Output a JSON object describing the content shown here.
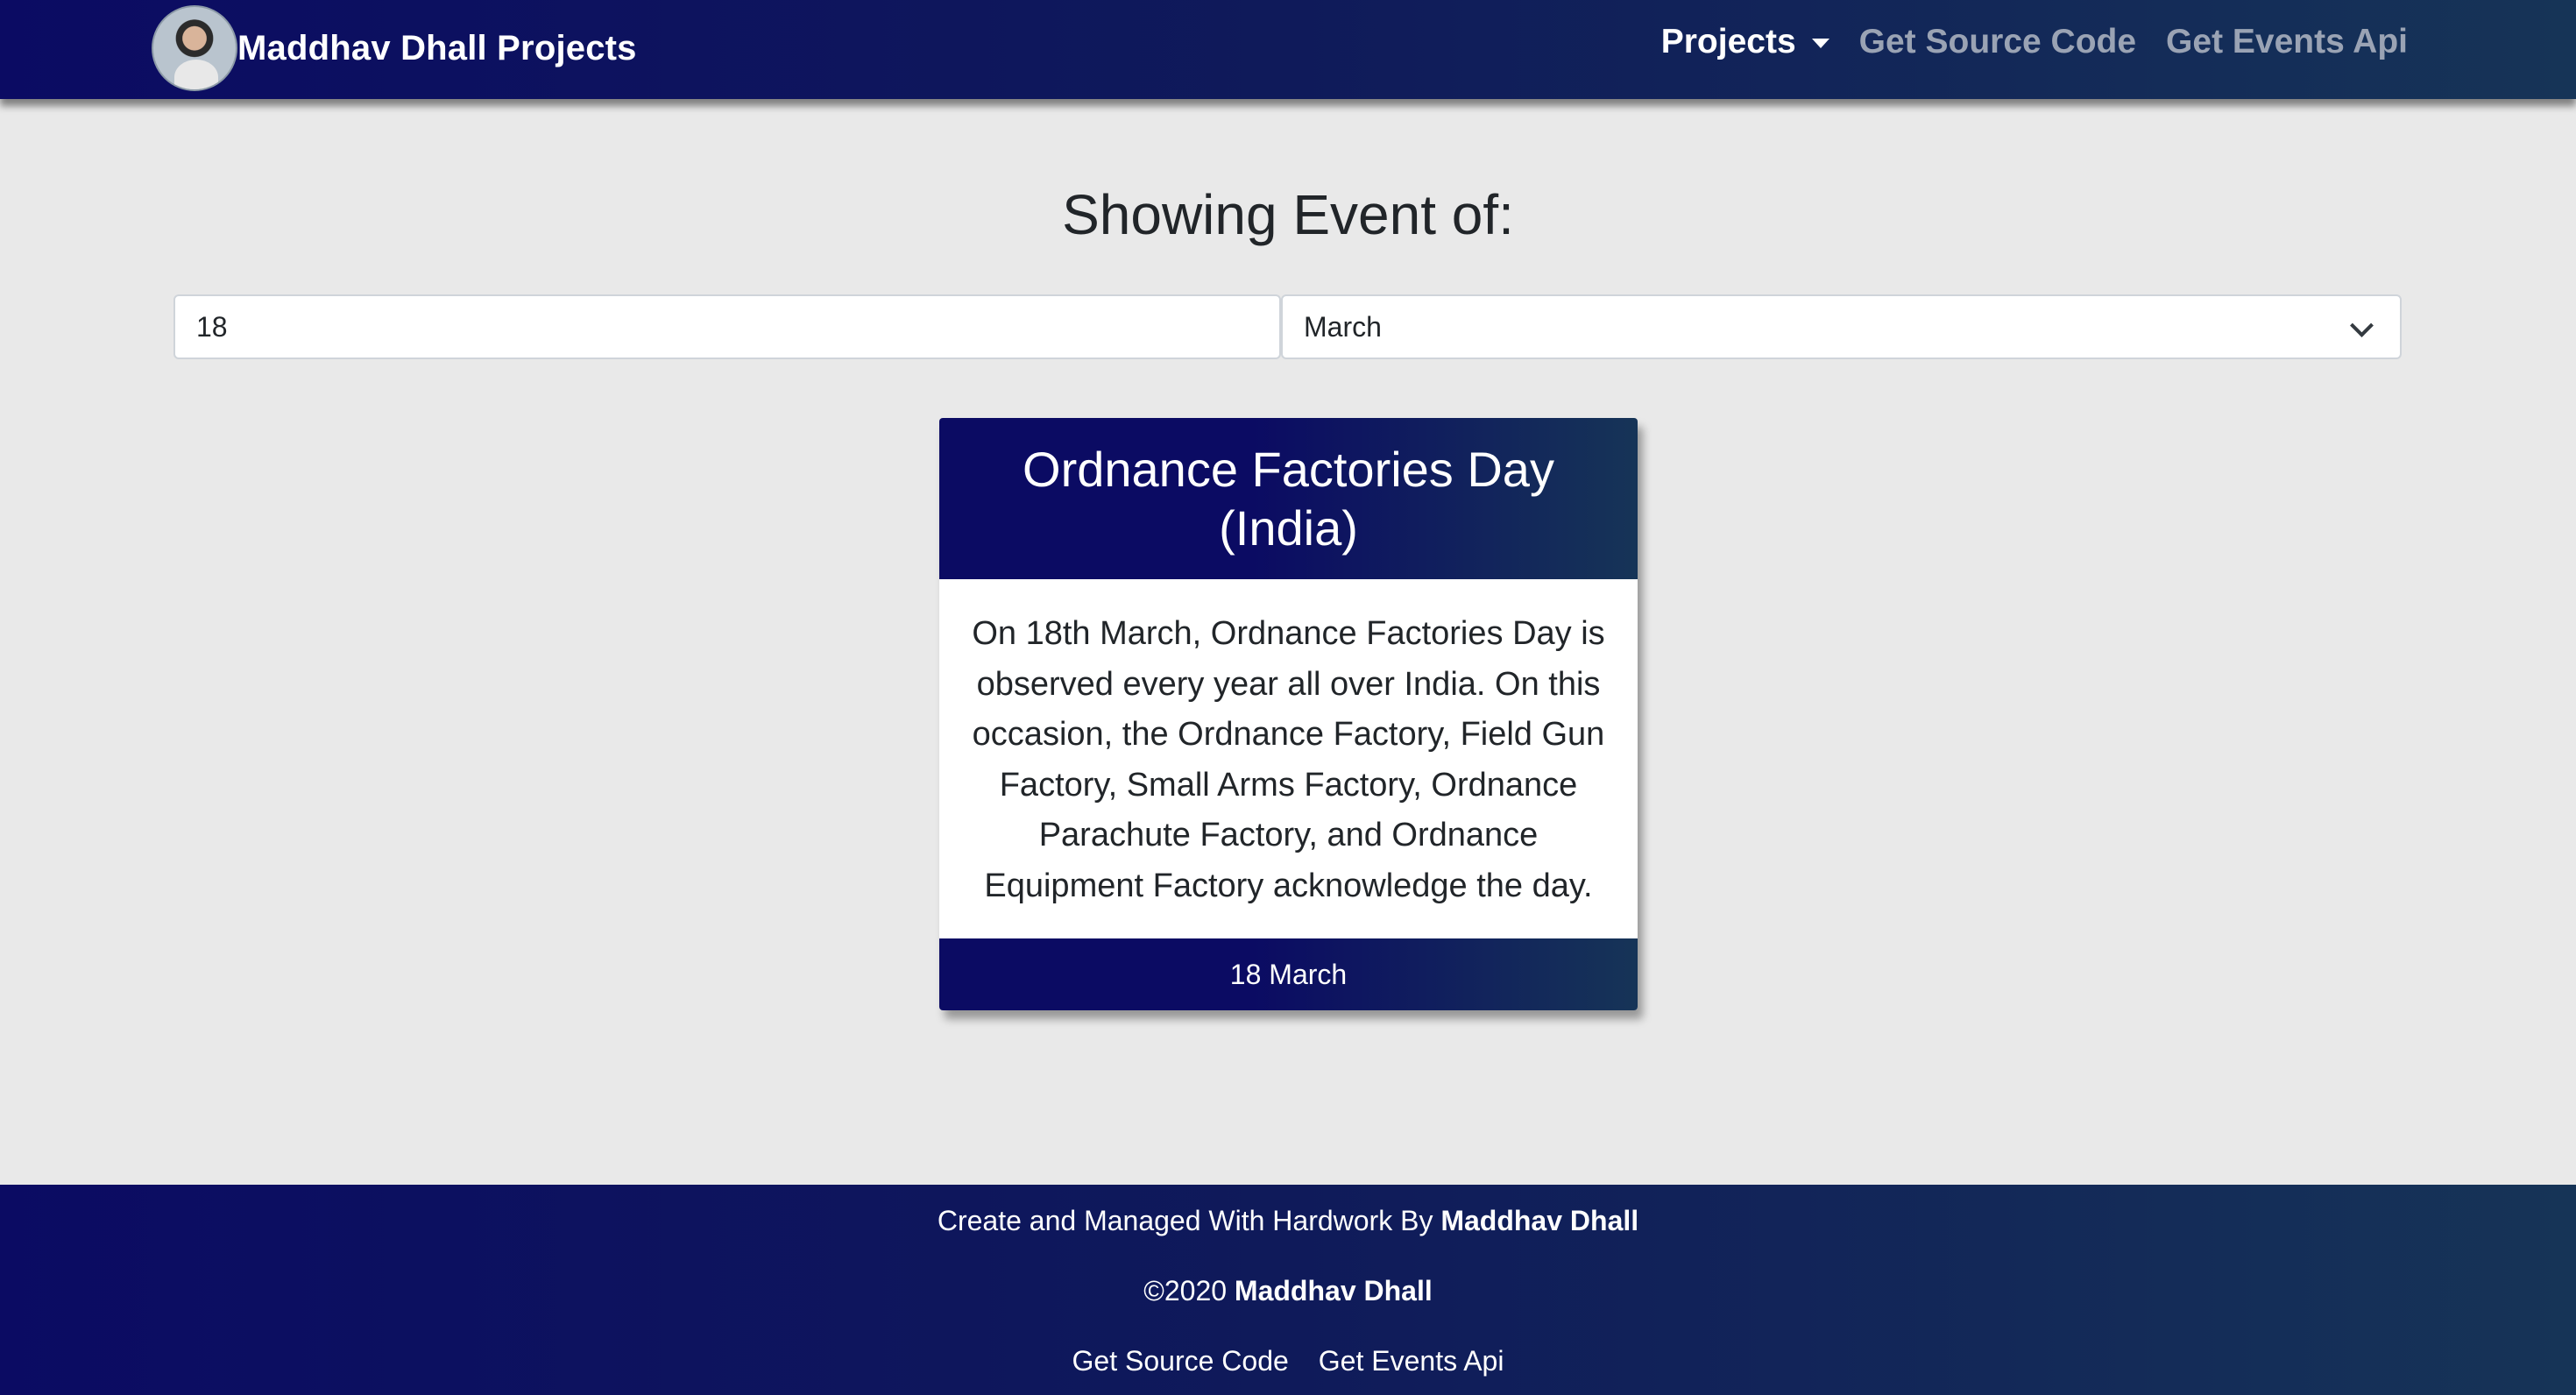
{
  "navbar": {
    "brand": "Maddhav Dhall Projects",
    "avatar_icon": "user-avatar-photo",
    "links": [
      {
        "label": "Projects",
        "active": true,
        "dropdown": true
      },
      {
        "label": "Get Source Code",
        "active": false
      },
      {
        "label": "Get Events Api",
        "active": false
      }
    ]
  },
  "main": {
    "heading": "Showing Event of:",
    "day_input_value": "18",
    "month_select_value": "March"
  },
  "event_card": {
    "title": "Ordnance Factories Day (India)",
    "description": "On 18th March, Ordnance Factories Day is observed every year all over India. On this occasion, the Ordnance Factory, Field Gun Factory, Small Arms Factory, Ordnance Parachute Factory, and Ordnance Equipment Factory acknowledge the day.",
    "date": "18 March"
  },
  "footer": {
    "credit_prefix": "Create and Managed With Hardwork By",
    "credit_name": "Maddhav Dhall",
    "copyright_prefix": "©2020",
    "copyright_name": "Maddhav Dhall",
    "links": [
      "Get Source Code",
      "Get Events Api"
    ]
  },
  "colors": {
    "nav_gradient_start": "#0b0b63",
    "nav_gradient_end": "#163457",
    "page_background": "#e9e9e9",
    "nav_link_muted": "#9aa3b4"
  }
}
